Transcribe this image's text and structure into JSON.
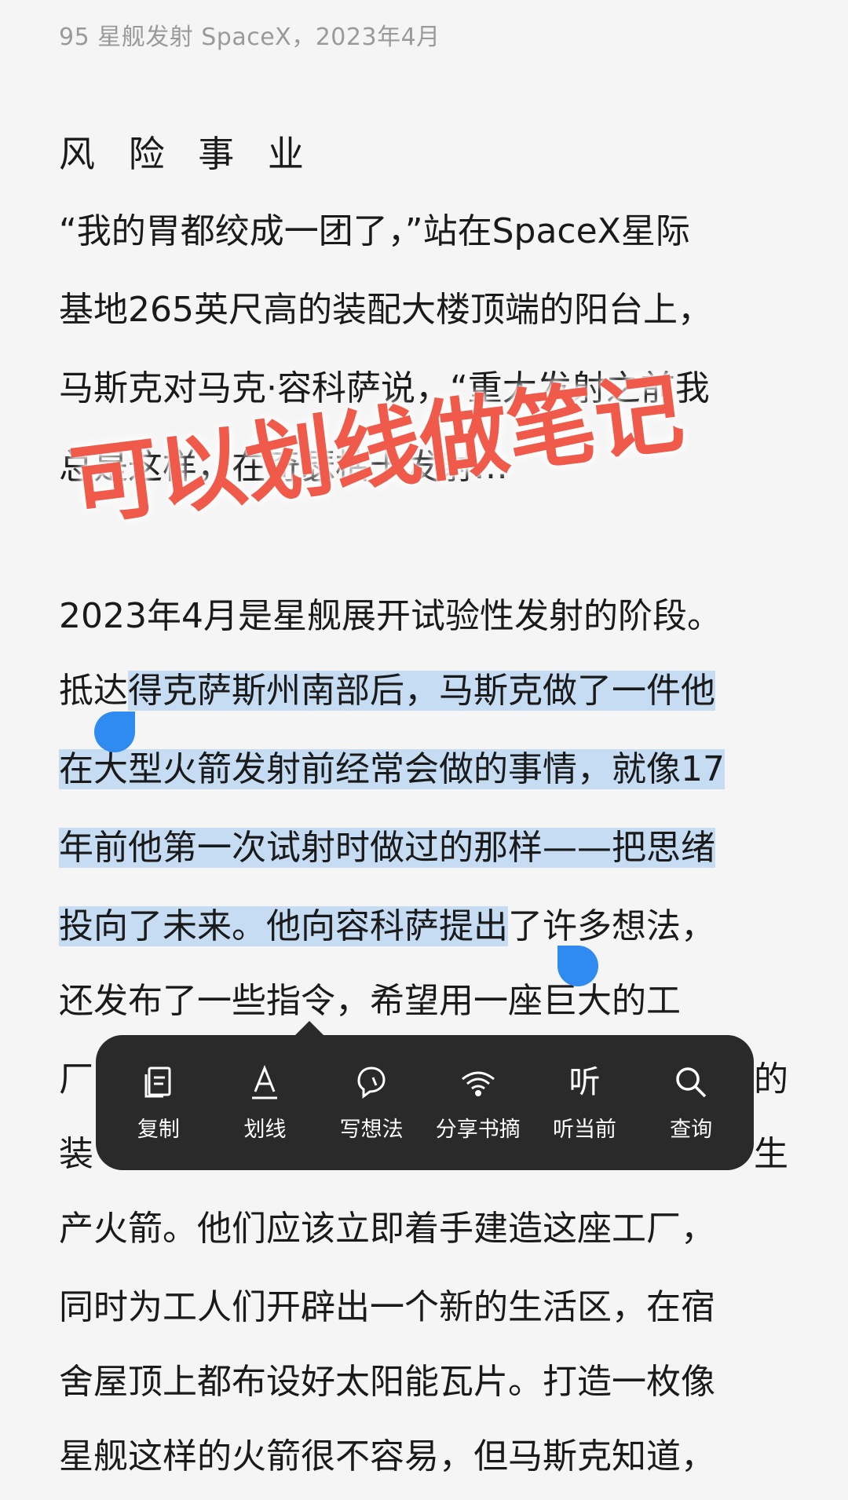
{
  "header": {
    "text": "95 星舰发射 SpaceX，2023年4月"
  },
  "section_title": "风 险 事 业",
  "paragraphs": {
    "line1": "“我的胃都绞成一团了，”站在SpaceX星际",
    "line2": "基地265英尺高的装配大楼顶端的阳台上，",
    "line3": "马斯克对马克·容科萨说，“重大发射之前我",
    "line4": "总是这样，在奇瑟枯卡发射…",
    "line5": "2023年4月是星舰展开试验性发射的阶段。",
    "line6_plain": "抵达",
    "line6_hl": "得克萨斯州南部后，马斯克做了一件他",
    "line7_hl": "在大型火箭发射前经常会做的事情，就像17",
    "line8_hl": "年前他第一次试射时做过的那样——把思绪",
    "line9_hl": "投向了未来。他向容科萨提出",
    "line9_plain": "了许多想法，",
    "line10": "还发布了一些指令，希望用一座巨大的工",
    "line11_left": "厂",
    "line11_right": "的",
    "line12_left": "装",
    "line12_right": "生",
    "line13": "产火箭。他们应该立即着手建造这座工厂，",
    "line14": "同时为工人们开辟出一个新的生活区，在宿",
    "line15": "舍屋顶上都布设好太阳能瓦片。打造一枚像",
    "line16": "星舰这样的火箭很不容易，但马斯克知道，"
  },
  "overlay_caption": "可以划线做笔记",
  "context_menu": {
    "items": [
      {
        "label": "复制",
        "icon": "copy-icon"
      },
      {
        "label": "划线",
        "icon": "underline-icon"
      },
      {
        "label": "写想法",
        "icon": "note-icon"
      },
      {
        "label": "分享书摘",
        "icon": "share-icon"
      },
      {
        "label": "听当前",
        "icon": "listen-icon",
        "glyph": "听"
      },
      {
        "label": "查询",
        "icon": "search-icon"
      }
    ]
  },
  "colors": {
    "highlight": "#c5dcf3",
    "handle": "#2f8bef",
    "overlay": "#f05a4a",
    "menu_bg": "#2a2a2a"
  }
}
